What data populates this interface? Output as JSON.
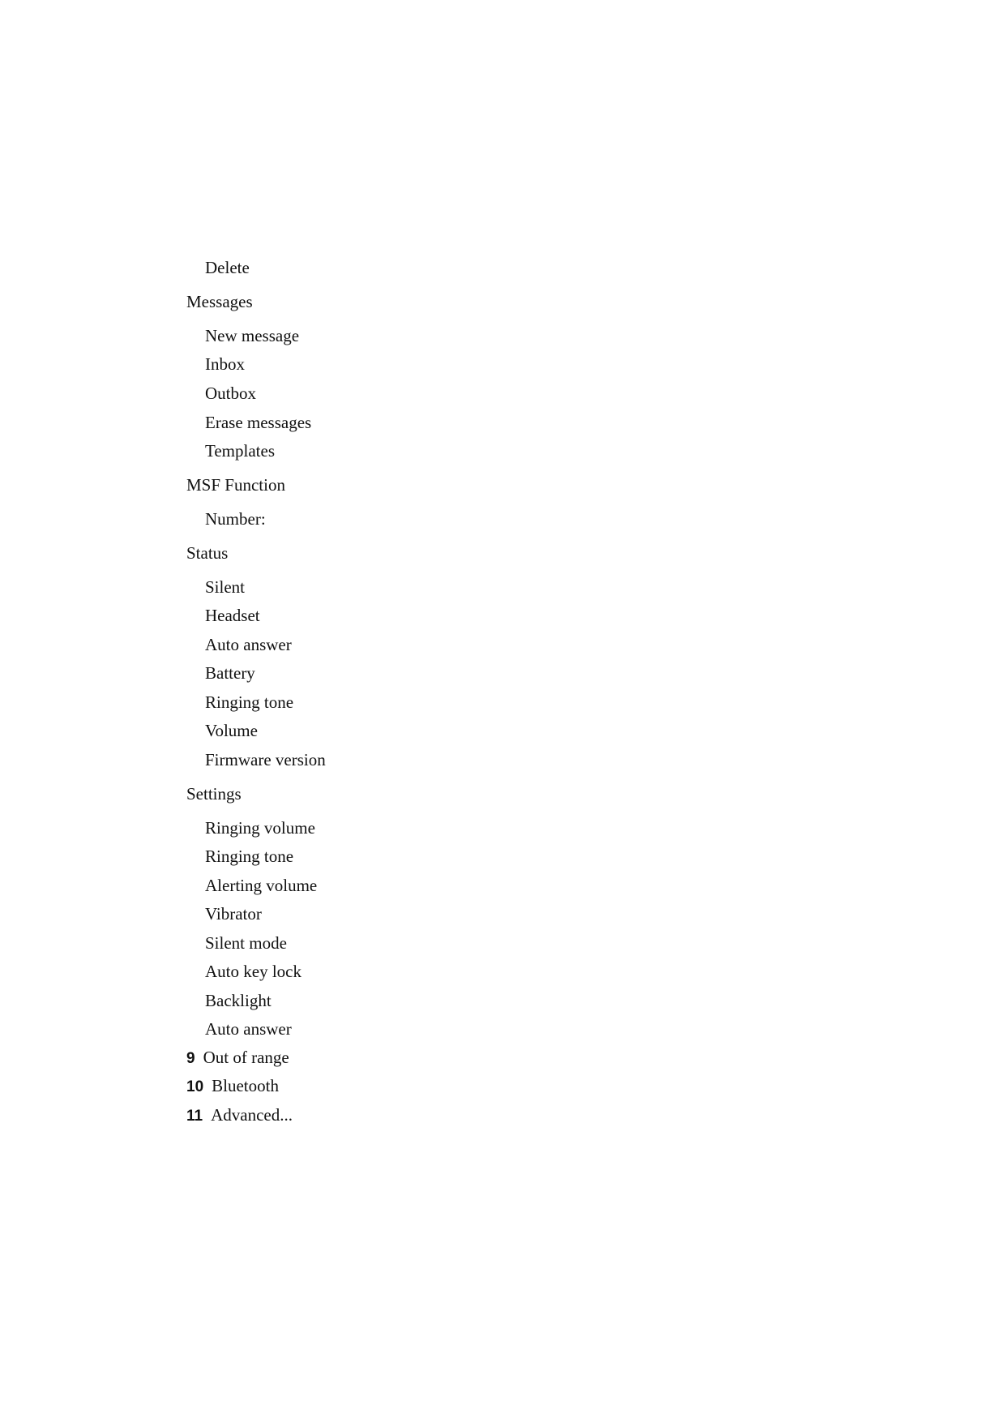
{
  "document": {
    "lines": [
      {
        "type": "item",
        "text": "Delete"
      },
      {
        "type": "heading",
        "text": "Messages"
      },
      {
        "type": "item",
        "text": "New message"
      },
      {
        "type": "item",
        "text": "Inbox"
      },
      {
        "type": "item",
        "text": "Outbox"
      },
      {
        "type": "item",
        "text": "Erase messages"
      },
      {
        "type": "item",
        "text": "Templates"
      },
      {
        "type": "heading",
        "text": "MSF Function"
      },
      {
        "type": "item",
        "text": "Number:"
      },
      {
        "type": "heading",
        "text": "Status"
      },
      {
        "type": "item",
        "text": "Silent"
      },
      {
        "type": "item",
        "text": "Headset"
      },
      {
        "type": "item",
        "text": "Auto answer"
      },
      {
        "type": "item",
        "text": "Battery"
      },
      {
        "type": "item",
        "text": "Ringing tone"
      },
      {
        "type": "item",
        "text": "Volume"
      },
      {
        "type": "item",
        "text": "Firmware version"
      },
      {
        "type": "heading",
        "text": "Settings"
      },
      {
        "type": "item",
        "text": "Ringing volume"
      },
      {
        "type": "item",
        "text": "Ringing tone"
      },
      {
        "type": "item",
        "text": "Alerting volume"
      },
      {
        "type": "item",
        "text": "Vibrator"
      },
      {
        "type": "item",
        "text": "Silent mode"
      },
      {
        "type": "item",
        "text": "Auto key lock"
      },
      {
        "type": "item",
        "text": "Backlight"
      },
      {
        "type": "item",
        "text": "Auto answer"
      },
      {
        "type": "numbered",
        "number": "9",
        "text": "Out of range"
      },
      {
        "type": "numbered",
        "number": "10",
        "text": "Bluetooth"
      },
      {
        "type": "numbered",
        "number": "11",
        "text": "Advanced..."
      }
    ]
  }
}
